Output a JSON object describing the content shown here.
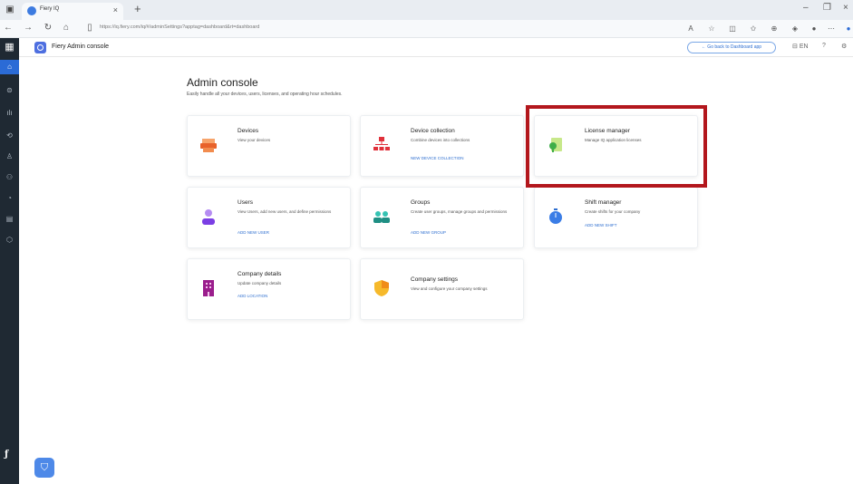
{
  "browser": {
    "tab_title": "Fiery IQ",
    "tab_close": "×",
    "new_tab": "+",
    "url": "https://iq.fiery.com/iq/#/adminSettings?apptag=dashboard&rt=dashboard",
    "window_controls": [
      "–",
      "❐",
      "×"
    ]
  },
  "app_header": {
    "title": "Fiery Admin console",
    "back_button": "← Go back to Dashboard app",
    "language": "EN"
  },
  "page": {
    "title": "Admin console",
    "subtitle": "Easily handle all your devices, users, licenses, and operating hour schedules."
  },
  "cards": [
    {
      "title": "Devices",
      "desc": "View your devices",
      "link": ""
    },
    {
      "title": "Device collection",
      "desc": "Combine devices into collections",
      "link": "NEW DEVICE COLLECTION"
    },
    {
      "title": "License manager",
      "desc": "Manage IQ application licenses",
      "link": ""
    },
    {
      "title": "Users",
      "desc": "View Users, add new users, and define permissions",
      "link": "ADD NEW USER"
    },
    {
      "title": "Groups",
      "desc": "Create user groups, manage groups and permissions",
      "link": "ADD NEW GROUP"
    },
    {
      "title": "Shift manager",
      "desc": "Create shifts for your company",
      "link": "ADD NEW SHIFT"
    },
    {
      "title": "Company details",
      "desc": "Update company details",
      "link": "ADD LOCATION"
    },
    {
      "title": "Company settings",
      "desc": "View and configure your company settings",
      "link": ""
    }
  ],
  "colors": {
    "sidebar": "#1f2933",
    "accent": "#2b6bd6",
    "link": "#2f6fd0",
    "highlight": "#b3171d"
  }
}
